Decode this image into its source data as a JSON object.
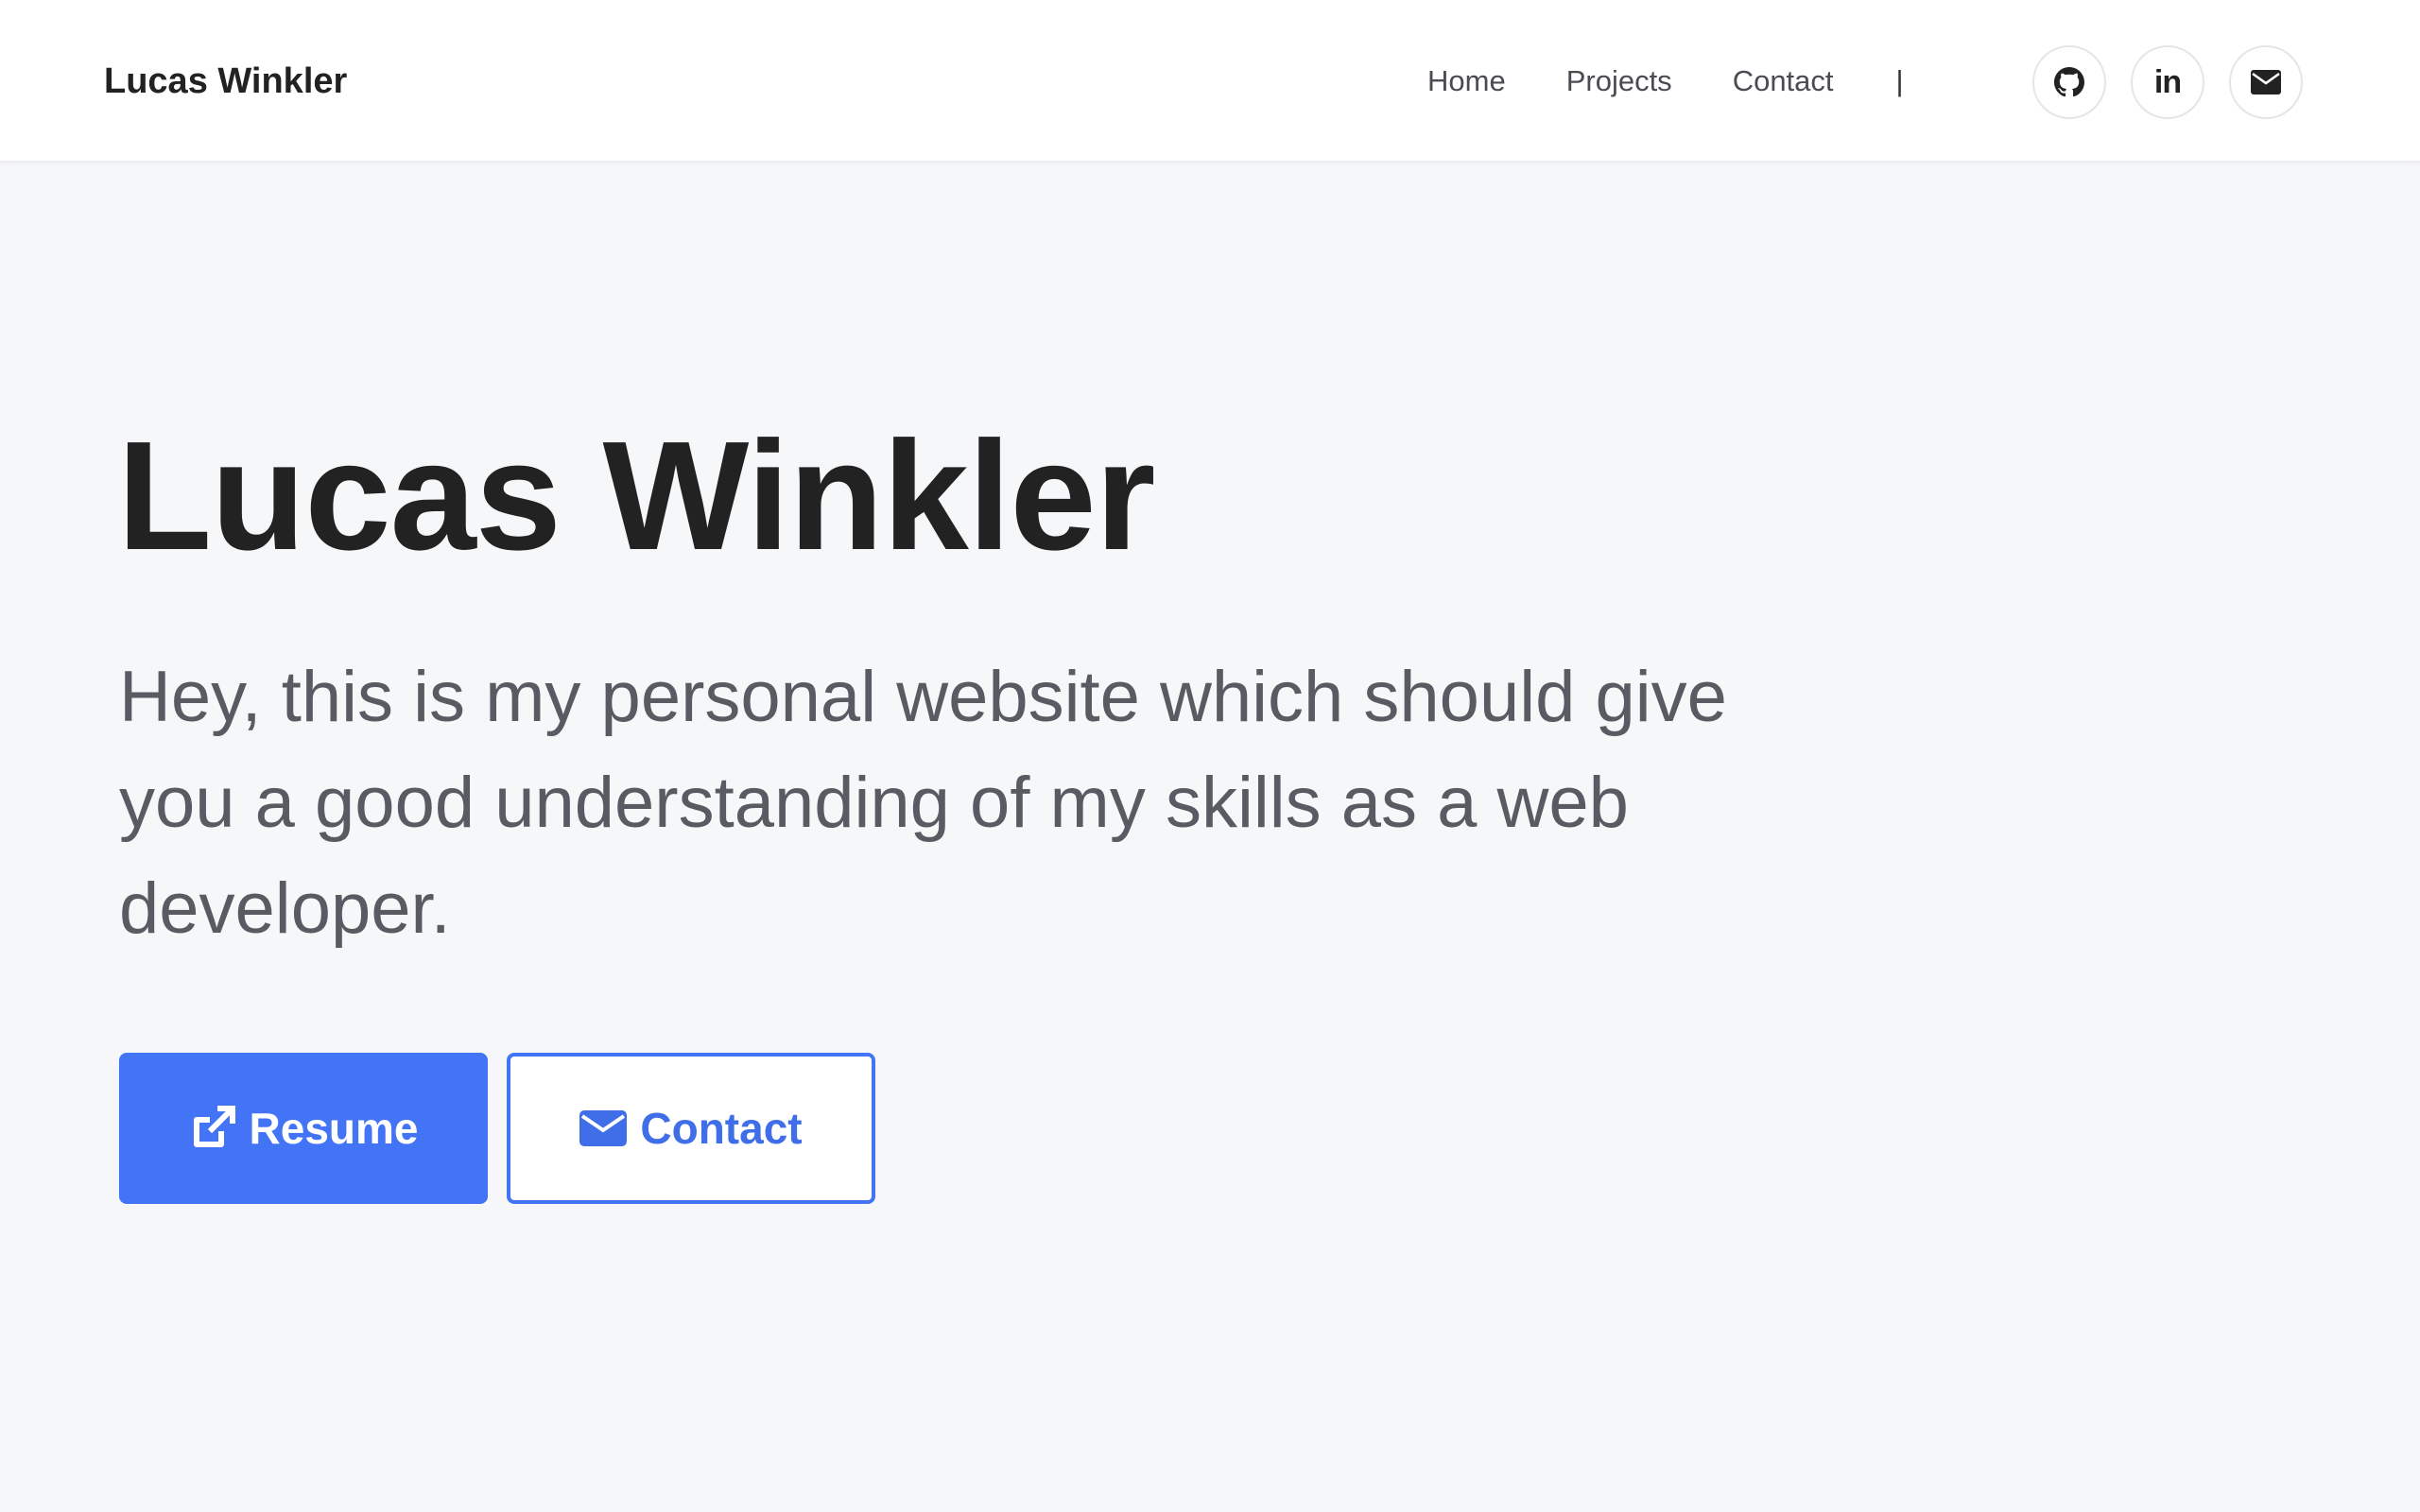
{
  "header": {
    "brand": "Lucas Winkler",
    "nav": [
      {
        "label": "Home"
      },
      {
        "label": "Projects"
      },
      {
        "label": "Contact"
      }
    ],
    "separator": "|",
    "social": [
      {
        "icon": "github-icon"
      },
      {
        "icon": "linkedin-icon",
        "glyph": "in"
      },
      {
        "icon": "envelope-icon"
      }
    ]
  },
  "hero": {
    "title": "Lucas Winkler",
    "text": "Hey, this is my personal website which should give you a good understanding of my skills as a web developer.",
    "buttons": {
      "resume_label": "Resume",
      "contact_label": "Contact"
    }
  },
  "colors": {
    "accent": "#4374f5",
    "background": "#f6f7f9",
    "header_bg": "#ffffff",
    "text_dark": "#222222",
    "text_muted": "#585b62"
  }
}
